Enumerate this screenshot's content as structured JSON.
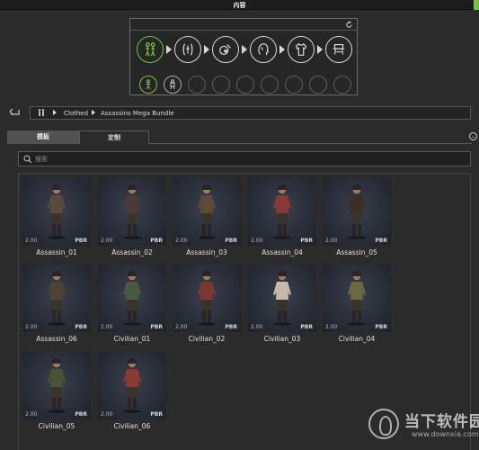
{
  "window": {
    "title": "内容",
    "accent_color": "#7bbf3a"
  },
  "category_icons": [
    {
      "name": "figures-icon",
      "active": true
    },
    {
      "name": "body-morph-icon",
      "active": false
    },
    {
      "name": "skin-icon",
      "active": false
    },
    {
      "name": "head-icon",
      "active": false
    },
    {
      "name": "clothing-icon",
      "active": false
    },
    {
      "name": "accessory-icon",
      "active": false
    }
  ],
  "subcategory_icons": [
    {
      "name": "character-icon",
      "active": true
    },
    {
      "name": "character-outline-icon",
      "active": false
    },
    {
      "name": "empty-slot",
      "active": false
    },
    {
      "name": "empty-slot",
      "active": false
    },
    {
      "name": "empty-slot",
      "active": false
    },
    {
      "name": "empty-slot",
      "active": false
    },
    {
      "name": "empty-slot",
      "active": false
    },
    {
      "name": "empty-slot",
      "active": false
    }
  ],
  "breadcrumb": {
    "items": [
      "Clothed",
      "Assassins Mega Bundle"
    ]
  },
  "tabs": [
    {
      "label": "模板",
      "active": true
    },
    {
      "label": "定制",
      "active": false
    }
  ],
  "search": {
    "placeholder": "搜索",
    "value": ""
  },
  "items": [
    {
      "name": "Assassin_01",
      "version": "2.00",
      "badge": "PBR",
      "color": "#5a4a3a"
    },
    {
      "name": "Assassin_02",
      "version": "2.00",
      "badge": "PBR",
      "color": "#4a3a38"
    },
    {
      "name": "Assassin_03",
      "version": "2.00",
      "badge": "PBR",
      "color": "#5e4838"
    },
    {
      "name": "Assassin_04",
      "version": "2.00",
      "badge": "PBR",
      "color": "#8a3a34"
    },
    {
      "name": "Assassin_05",
      "version": "2.00",
      "badge": "PBR",
      "color": "#3e2e2a"
    },
    {
      "name": "Assassin_06",
      "version": "2.00",
      "badge": "PBR",
      "color": "#4e4232"
    },
    {
      "name": "Civilian_01",
      "version": "2.00",
      "badge": "PBR",
      "color": "#4a5a3e"
    },
    {
      "name": "Civilian_02",
      "version": "2.00",
      "badge": "PBR",
      "color": "#7a3830"
    },
    {
      "name": "Civilian_03",
      "version": "2.00",
      "badge": "PBR",
      "color": "#c8b8a8"
    },
    {
      "name": "Civilian_04",
      "version": "2.00",
      "badge": "PBR",
      "color": "#6a6a40"
    },
    {
      "name": "Civilian_05",
      "version": "2.00",
      "badge": "PBR",
      "color": "#4a5234"
    },
    {
      "name": "Civilian_06",
      "version": "2.00",
      "badge": "PBR",
      "color": "#8a3a30"
    }
  ],
  "watermark": {
    "text": "当下软件园",
    "url": "www.downxia.com"
  }
}
